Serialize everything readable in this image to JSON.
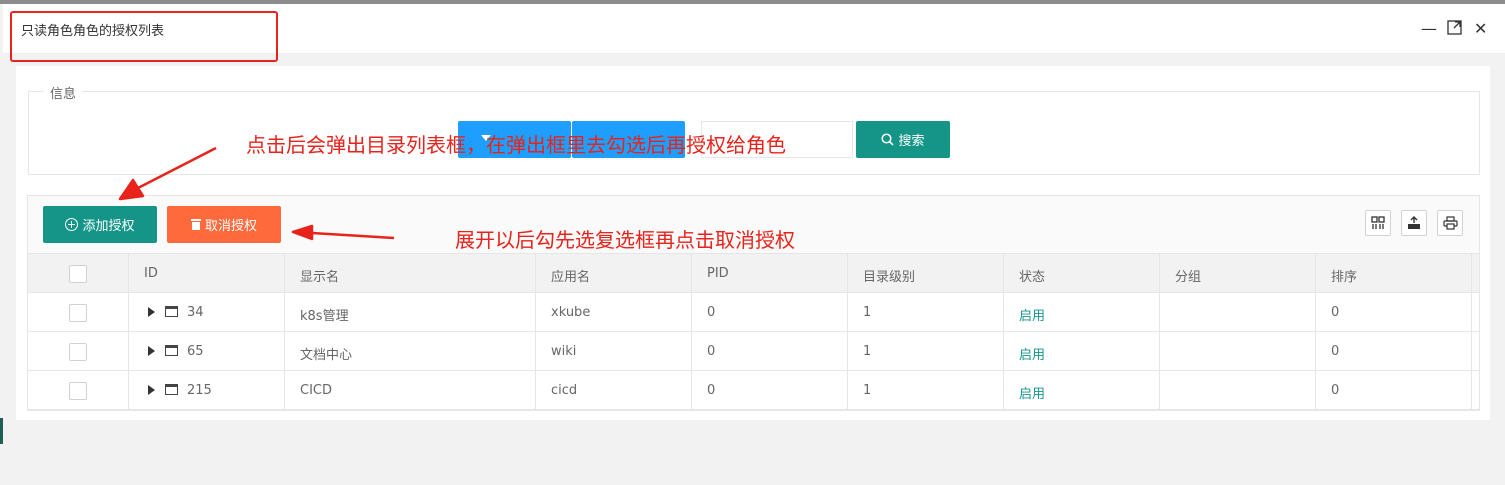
{
  "dialog": {
    "title": "只读角色角色的授权列表",
    "controls": [
      "minimize-icon",
      "maximize-icon",
      "close-icon"
    ]
  },
  "filter": {
    "legend": "信息",
    "search_label": "搜索"
  },
  "annotations": {
    "top": "点击后会弹出目录列表框，在弹出框里去勾选后再授权给角色",
    "bottom": "展开以后勾先选复选框再点击取消授权"
  },
  "toolbar": {
    "add_label": "添加授权",
    "revoke_label": "取消授权",
    "tools": [
      "columns-icon",
      "export-icon",
      "print-icon"
    ]
  },
  "table": {
    "columns": [
      "ID",
      "显示名",
      "应用名",
      "PID",
      "目录级别",
      "状态",
      "分组",
      "排序"
    ],
    "rows": [
      {
        "id": "34",
        "name": "k8s管理",
        "app": "xkube",
        "pid": "0",
        "level": "1",
        "status": "启用",
        "group": "",
        "sort": "0"
      },
      {
        "id": "65",
        "name": "文档中心",
        "app": "wiki",
        "pid": "0",
        "level": "1",
        "status": "启用",
        "group": "",
        "sort": "0"
      },
      {
        "id": "215",
        "name": "CICD",
        "app": "cicd",
        "pid": "0",
        "level": "1",
        "status": "启用",
        "group": "",
        "sort": "0"
      }
    ]
  },
  "colors": {
    "primary": "#159588",
    "danger": "#ff6a3d",
    "blue": "#1e9fff",
    "annotation": "#e8231b"
  }
}
